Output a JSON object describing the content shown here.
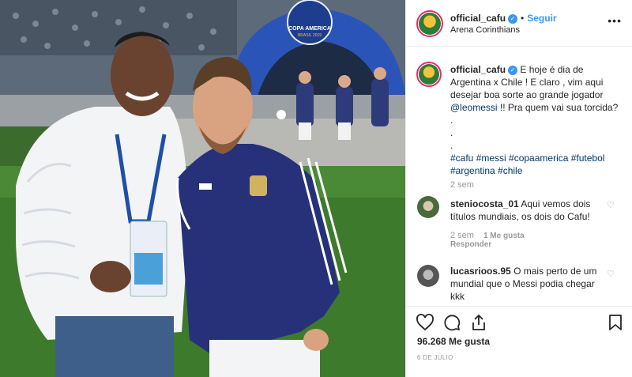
{
  "photo": {
    "alt_icon": "photo-image",
    "banner": "COPA AMERICA",
    "banner_sub": "BRASIL 2019"
  },
  "header": {
    "username": "official_cafu",
    "separator": "•",
    "follow_label": "Seguir",
    "location": "Arena Corinthians",
    "more_label": "•••"
  },
  "caption": {
    "username": "official_cafu",
    "text_1": "E hoje é dia de Argentina x Chile ! E claro , vim aqui desejar boa sorte ao grande jogador ",
    "mention": "@leomessi",
    "text_2": " !! Pra quem vai sua torcida? .",
    "dots": ".",
    "dots2": ".",
    "hashtags": "#cafu #messi #copaamerica #futebol #argentina #chile",
    "time": "2 sem"
  },
  "comments": [
    {
      "username": "steniocosta_01",
      "text": "Aqui vemos dois títulos mundiais, os dois do Cafu!",
      "time": "2 sem",
      "likes": "1 Me gusta",
      "reply": "Responder"
    },
    {
      "username": "lucasrioos.95",
      "text": "O mais perto de um mundial que o Messi podia chegar kkk"
    }
  ],
  "footer": {
    "likes": "96.268 Me gusta",
    "date": "6 DE JULIO"
  },
  "colors": {
    "link": "#003569",
    "follow": "#3897f0",
    "muted": "#999999",
    "border": "#efefef"
  }
}
